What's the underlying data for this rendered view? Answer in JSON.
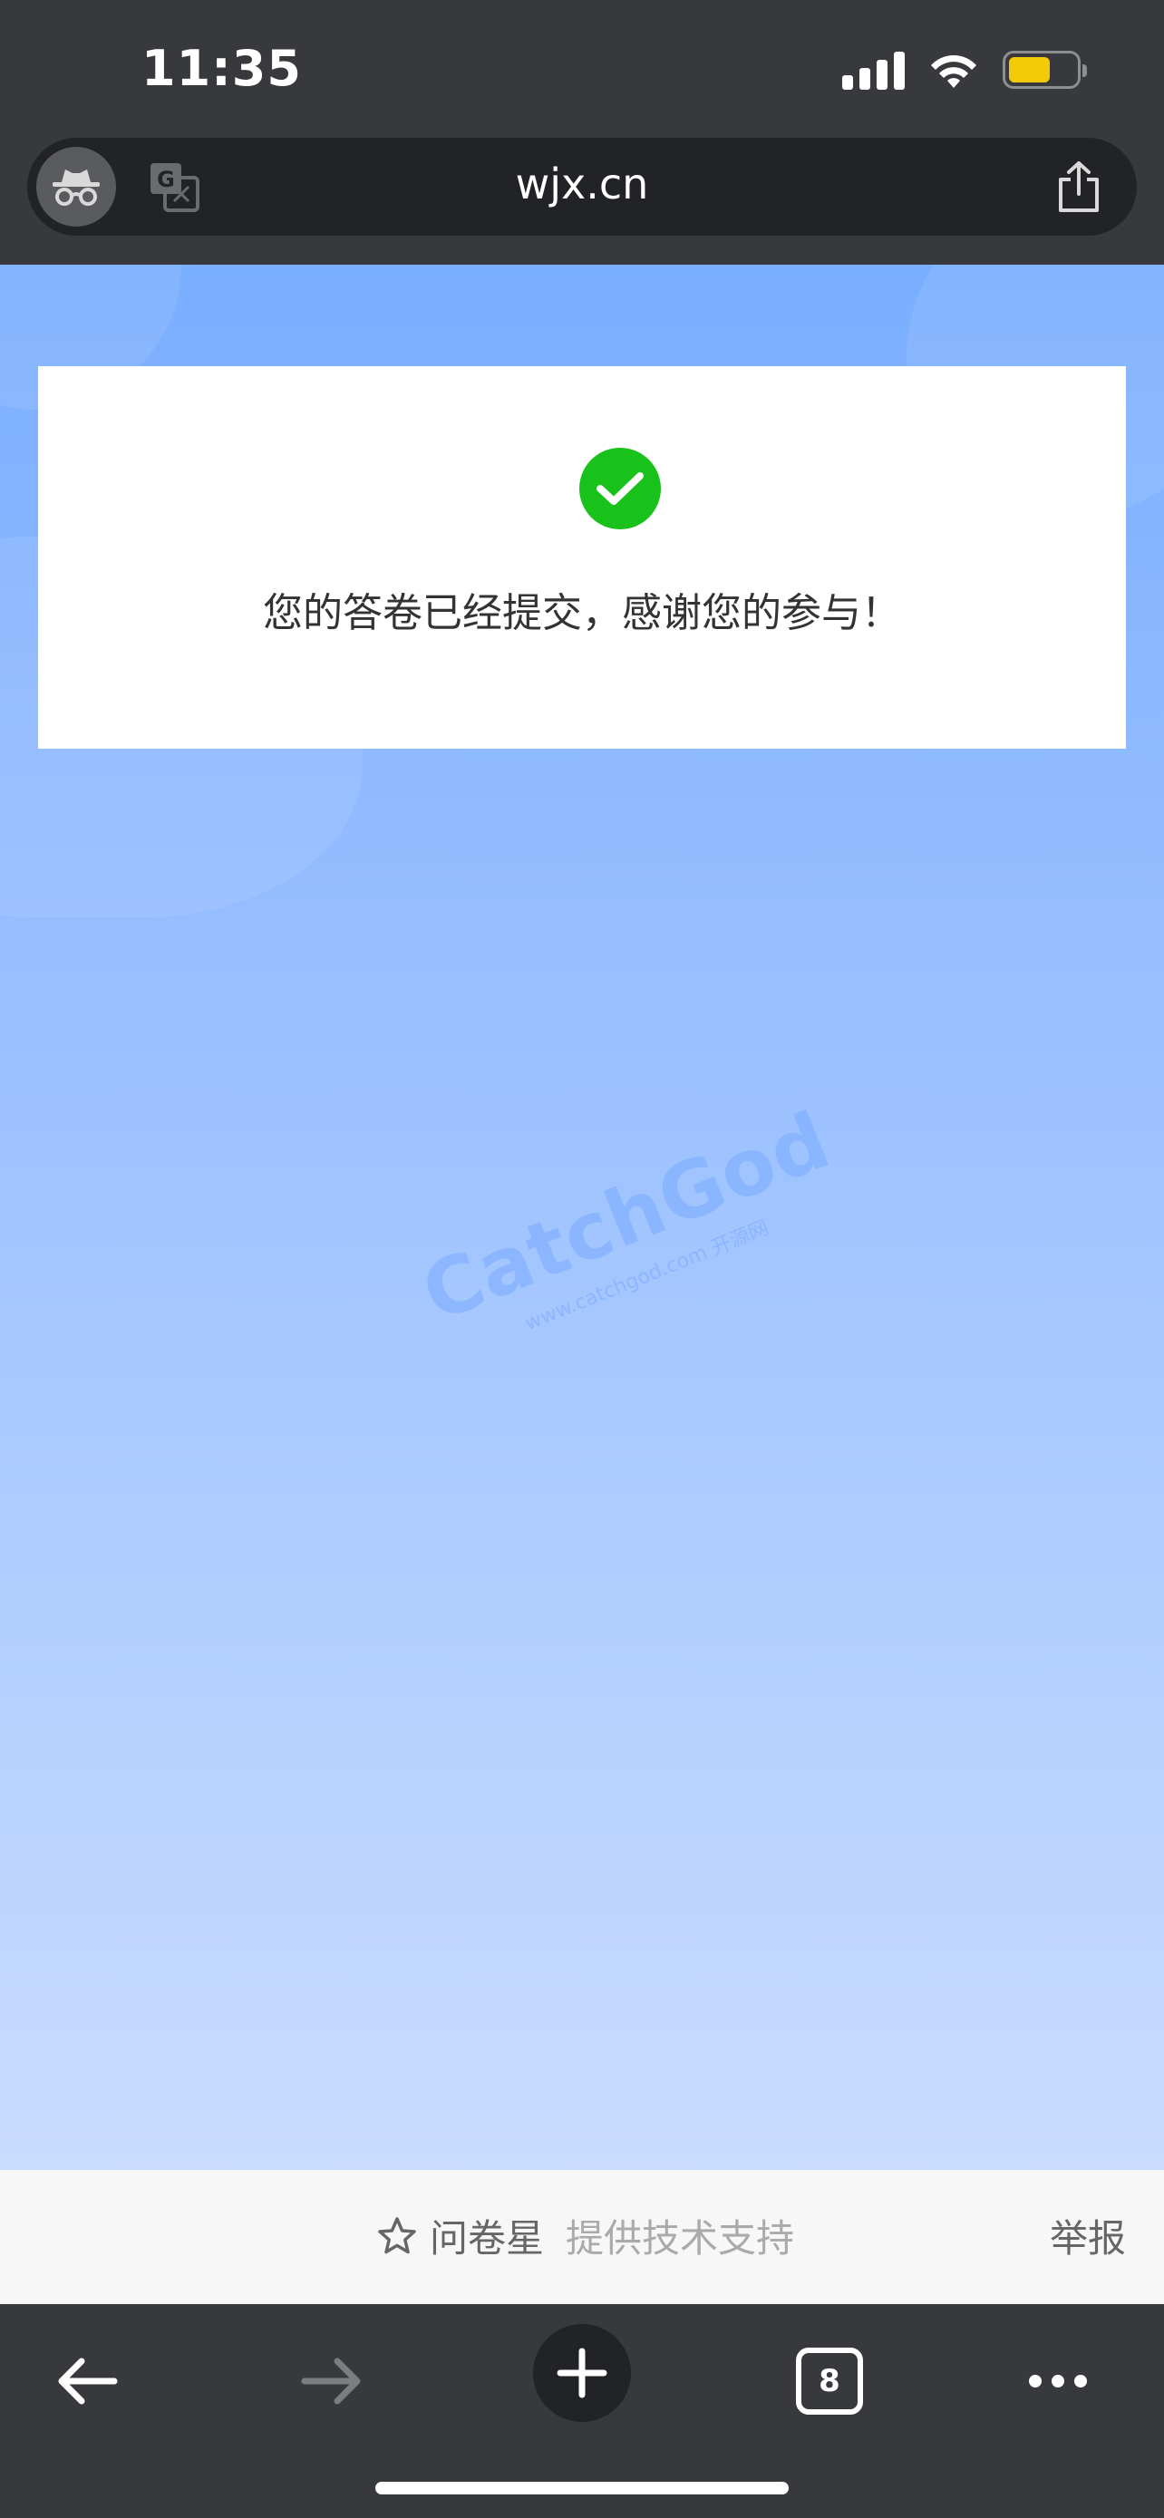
{
  "status_bar": {
    "time": "11:35"
  },
  "browser": {
    "url": "wjx.cn",
    "tab_count": "8"
  },
  "page": {
    "confirmation_message": "您的答卷已经提交，感谢您的参与！",
    "watermark": {
      "brand": "CatchGod",
      "subtitle": "www.catchgod.com 开源网"
    },
    "footer": {
      "brand_name": "问卷星",
      "brand_tagline": "提供技术支持",
      "report_label": "举报"
    }
  },
  "icons": {
    "incognito": "incognito-icon",
    "translate": "translate-icon",
    "share": "share-icon",
    "success": "check-icon",
    "star": "star-icon",
    "back": "arrow-left-icon",
    "forward": "arrow-right-icon",
    "new_tab": "plus-icon",
    "tabs": "tabs-icon",
    "menu": "more-icon"
  },
  "colors": {
    "success_green": "#19c21b",
    "battery": "#f2cb06",
    "page_gradient_top": "#7aaeff",
    "page_gradient_bottom": "#c9dcff"
  }
}
